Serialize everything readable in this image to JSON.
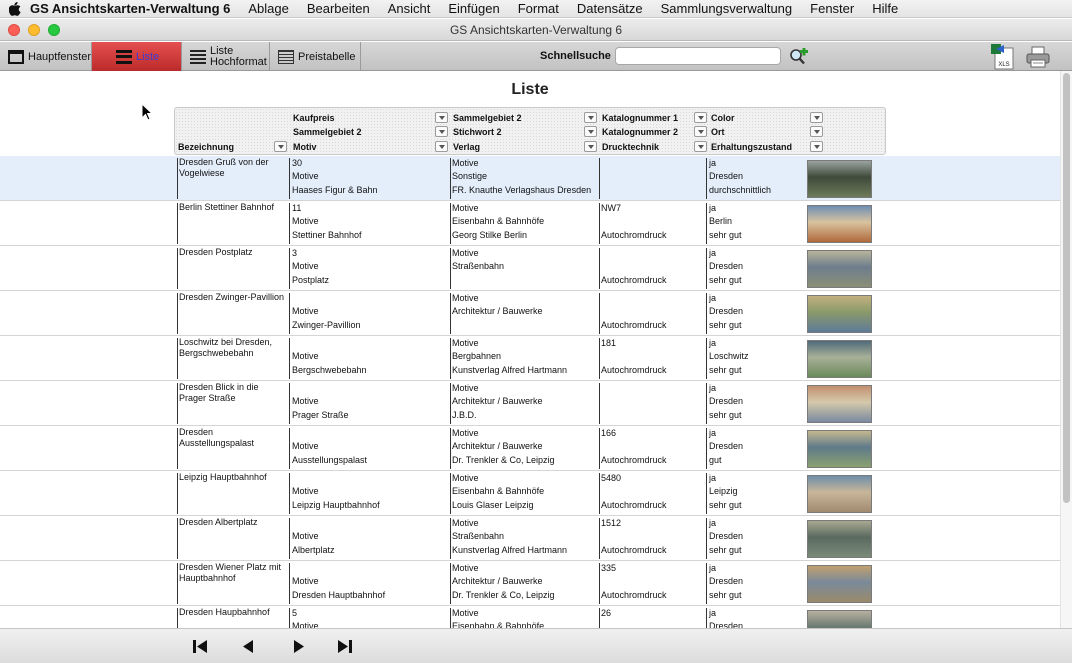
{
  "menubar": {
    "app_name": "GS Ansichtskarten-Verwaltung 6",
    "items": [
      "Ablage",
      "Bearbeiten",
      "Ansicht",
      "Einfügen",
      "Format",
      "Datensätze",
      "Sammlungsverwaltung",
      "Fenster",
      "Hilfe"
    ]
  },
  "window": {
    "title": "GS Ansichtskarten-Verwaltung 6"
  },
  "toolbar": {
    "main_window_label": "Hauptfenster",
    "list_label": "Liste",
    "list_portrait_line1": "Liste",
    "list_portrait_line2": "Hochformat",
    "price_table_label": "Preistabelle",
    "quick_search_label": "Schnellsuche",
    "quick_search_value": "",
    "xls_label": "XLS"
  },
  "page": {
    "title": "Liste"
  },
  "columns": {
    "name": "Bezeichnung",
    "price": "Kaufpreis",
    "area2": "Sammelgebiet 2",
    "motif": "Motiv",
    "area2b": "Sammelgebiet 2",
    "keyword2": "Stichwort 2",
    "publisher": "Verlag",
    "catalog1": "Katalognummer 1",
    "catalog2": "Katalognummer 2",
    "print_tech": "Drucktechnik",
    "color": "Color",
    "place": "Ort",
    "condition": "Erhaltungszustand"
  },
  "rows": [
    {
      "name": "Dresden Gruß von der Vogelwiese",
      "price": "30",
      "area": "Motive",
      "motif": "Haases Figur & Bahn",
      "area2": "Motive",
      "keyword": "Sonstige",
      "publisher": "FR. Knauthe Verlagshaus Dresden",
      "cat1": "",
      "cat2": "",
      "tech": "",
      "color": "ja",
      "place": "Dresden",
      "cond": "durchschnittlich"
    },
    {
      "name": "Berlin Stettiner Bahnhof",
      "price": "11",
      "area": "Motive",
      "motif": "Stettiner Bahnhof",
      "area2": "Motive",
      "keyword": "Eisenbahn & Bahnhöfe",
      "publisher": "Georg Stilke Berlin",
      "cat1": "NW7",
      "cat2": "",
      "tech": "Autochromdruck",
      "color": "ja",
      "place": "Berlin",
      "cond": "sehr gut"
    },
    {
      "name": "Dresden Postplatz",
      "price": "3",
      "area": "Motive",
      "motif": "Postplatz",
      "area2": "Motive",
      "keyword": "Straßenbahn",
      "publisher": "",
      "cat1": "",
      "cat2": "",
      "tech": "Autochromdruck",
      "color": "ja",
      "place": "Dresden",
      "cond": "sehr gut"
    },
    {
      "name": "Dresden Zwinger-Pavillion",
      "price": "",
      "area": "Motive",
      "motif": "Zwinger-Pavillion",
      "area2": "Motive",
      "keyword": "Architektur / Bauwerke",
      "publisher": "",
      "cat1": "",
      "cat2": "",
      "tech": "Autochromdruck",
      "color": "ja",
      "place": "Dresden",
      "cond": "sehr gut"
    },
    {
      "name": "Loschwitz bei Dresden, Bergschwebebahn",
      "price": "",
      "area": "Motive",
      "motif": "Bergschwebebahn",
      "area2": "Motive",
      "keyword": "Bergbahnen",
      "publisher": "Kunstverlag Alfred Hartmann",
      "cat1": "181",
      "cat2": "",
      "tech": "Autochromdruck",
      "color": "ja",
      "place": "Loschwitz",
      "cond": "sehr gut"
    },
    {
      "name": "Dresden Blick in die Prager Straße",
      "price": "",
      "area": "Motive",
      "motif": "Prager Straße",
      "area2": "Motive",
      "keyword": "Architektur / Bauwerke",
      "publisher": "J.B.D.",
      "cat1": "",
      "cat2": "",
      "tech": "",
      "color": "ja",
      "place": "Dresden",
      "cond": "sehr gut"
    },
    {
      "name": "Dresden Ausstellungspalast",
      "price": "",
      "area": "Motive",
      "motif": "Ausstellungspalast",
      "area2": "Motive",
      "keyword": "Architektur / Bauwerke",
      "publisher": "Dr. Trenkler & Co, Leipzig",
      "cat1": "166",
      "cat2": "",
      "tech": "Autochromdruck",
      "color": "ja",
      "place": "Dresden",
      "cond": "gut"
    },
    {
      "name": "Leipzig Hauptbahnhof",
      "price": "",
      "area": "Motive",
      "motif": "Leipzig Hauptbahnhof",
      "area2": "Motive",
      "keyword": "Eisenbahn & Bahnhöfe",
      "publisher": "Louis Glaser Leipzig",
      "cat1": "5480",
      "cat2": "",
      "tech": "Autochromdruck",
      "color": "ja",
      "place": "Leipzig",
      "cond": "sehr gut"
    },
    {
      "name": "Dresden Albertplatz",
      "price": "",
      "area": "Motive",
      "motif": "Albertplatz",
      "area2": "Motive",
      "keyword": "Straßenbahn",
      "publisher": "Kunstverlag Alfred Hartmann",
      "cat1": "1512",
      "cat2": "",
      "tech": "Autochromdruck",
      "color": "ja",
      "place": "Dresden",
      "cond": "sehr gut"
    },
    {
      "name": "Dresden Wiener Platz mit Hauptbahnhof",
      "price": "",
      "area": "Motive",
      "motif": "Dresden Hauptbahnhof",
      "area2": "Motive",
      "keyword": "Architektur / Bauwerke",
      "publisher": "Dr. Trenkler & Co, Leipzig",
      "cat1": "335",
      "cat2": "",
      "tech": "Autochromdruck",
      "color": "ja",
      "place": "Dresden",
      "cond": "sehr gut"
    },
    {
      "name": "Dresden Haupbahnhof",
      "price": "5",
      "area": "Motive",
      "motif": "",
      "area2": "Motive",
      "keyword": "Eisenbahn & Bahnhöfe",
      "publisher": "",
      "cat1": "26",
      "cat2": "",
      "tech": "",
      "color": "ja",
      "place": "Dresden",
      "cond": ""
    }
  ],
  "colors": {
    "accent_active": "#d23b3b",
    "selection": "#e4eefb"
  },
  "icons": {
    "search_go": "magnifier-plus-icon",
    "xls": "excel-export-icon",
    "print": "printer-icon"
  }
}
